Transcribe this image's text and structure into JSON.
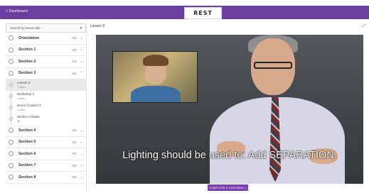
{
  "header": {
    "back_label": "< Dashboard",
    "logo_text": "REST"
  },
  "sidebar": {
    "search_placeholder": "Search by lesson title",
    "sections_top": [
      {
        "name": "Orientation",
        "count": "0/2",
        "expanded": false
      },
      {
        "name": "Section 1",
        "count": "0/3",
        "expanded": false
      },
      {
        "name": "Section 2",
        "count": "1/4",
        "expanded": false
      },
      {
        "name": "Section 3",
        "count": "0/4",
        "expanded": true
      }
    ],
    "lessons": [
      {
        "title": "Lesson 3",
        "meta": "1 video",
        "active": true
      },
      {
        "title": "Workshop 3",
        "meta": "1 video",
        "active": false
      },
      {
        "title": "Bonus Content 3",
        "meta": "1 video",
        "active": false
      },
      {
        "title": "Section 3 Notes",
        "meta": "file",
        "active": false
      }
    ],
    "sections_bottom": [
      {
        "name": "Section 4",
        "count": "0/4"
      },
      {
        "name": "Section 5",
        "count": "0/4"
      },
      {
        "name": "Section 6",
        "count": "0/4"
      },
      {
        "name": "Section 7",
        "count": "0/4"
      },
      {
        "name": "Section 8",
        "count": "0/5"
      }
    ]
  },
  "main": {
    "lesson_title": "Lesson 3",
    "caption": "Lighting should be used to: Add SEPARATION.",
    "complete_button": "COMPLETE & CONTINUE  >"
  },
  "colors": {
    "brand": "#6b3fa0",
    "button": "#7b3fb0"
  }
}
